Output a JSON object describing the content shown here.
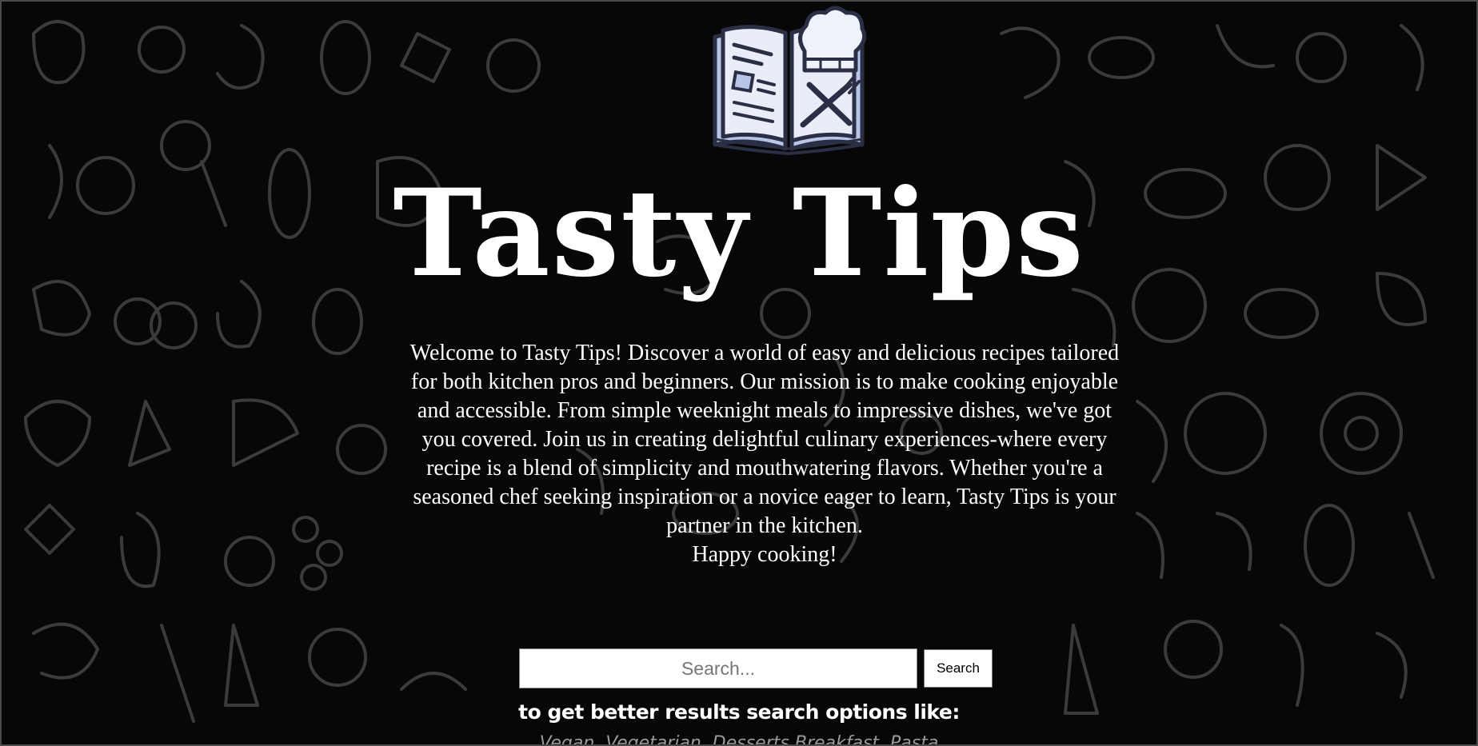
{
  "logo": {
    "icon": "recipe-book-chef-hat-icon",
    "colors": {
      "pages": "#b8c4e8",
      "outline": "#2b2f45",
      "hat": "#eef2fb"
    }
  },
  "header": {
    "title": "Tasty Tips"
  },
  "intro": {
    "text": "Welcome to Tasty Tips! Discover a world of easy and delicious recipes tailored for both kitchen pros and beginners. Our mission is to make cooking enjoyable and accessible. From simple weeknight meals to impressive dishes, we've got you covered. Join us in creating delightful culinary experiences-where every recipe is a blend of simplicity and mouthwatering flavors. Whether you're a seasoned chef seeking inspiration or a novice eager to learn, Tasty Tips is your partner in the kitchen.",
    "closing": "Happy cooking!"
  },
  "search": {
    "placeholder": "Search...",
    "value": "",
    "button_label": "Search"
  },
  "hint": {
    "text": "to get better results search options like:",
    "options": "Vegan, Vegetarian, Desserts,Breakfast, Pasta"
  },
  "theme": {
    "background": "#070707",
    "doodle_stroke": "#3b3b3b",
    "text": "#ffffff"
  }
}
